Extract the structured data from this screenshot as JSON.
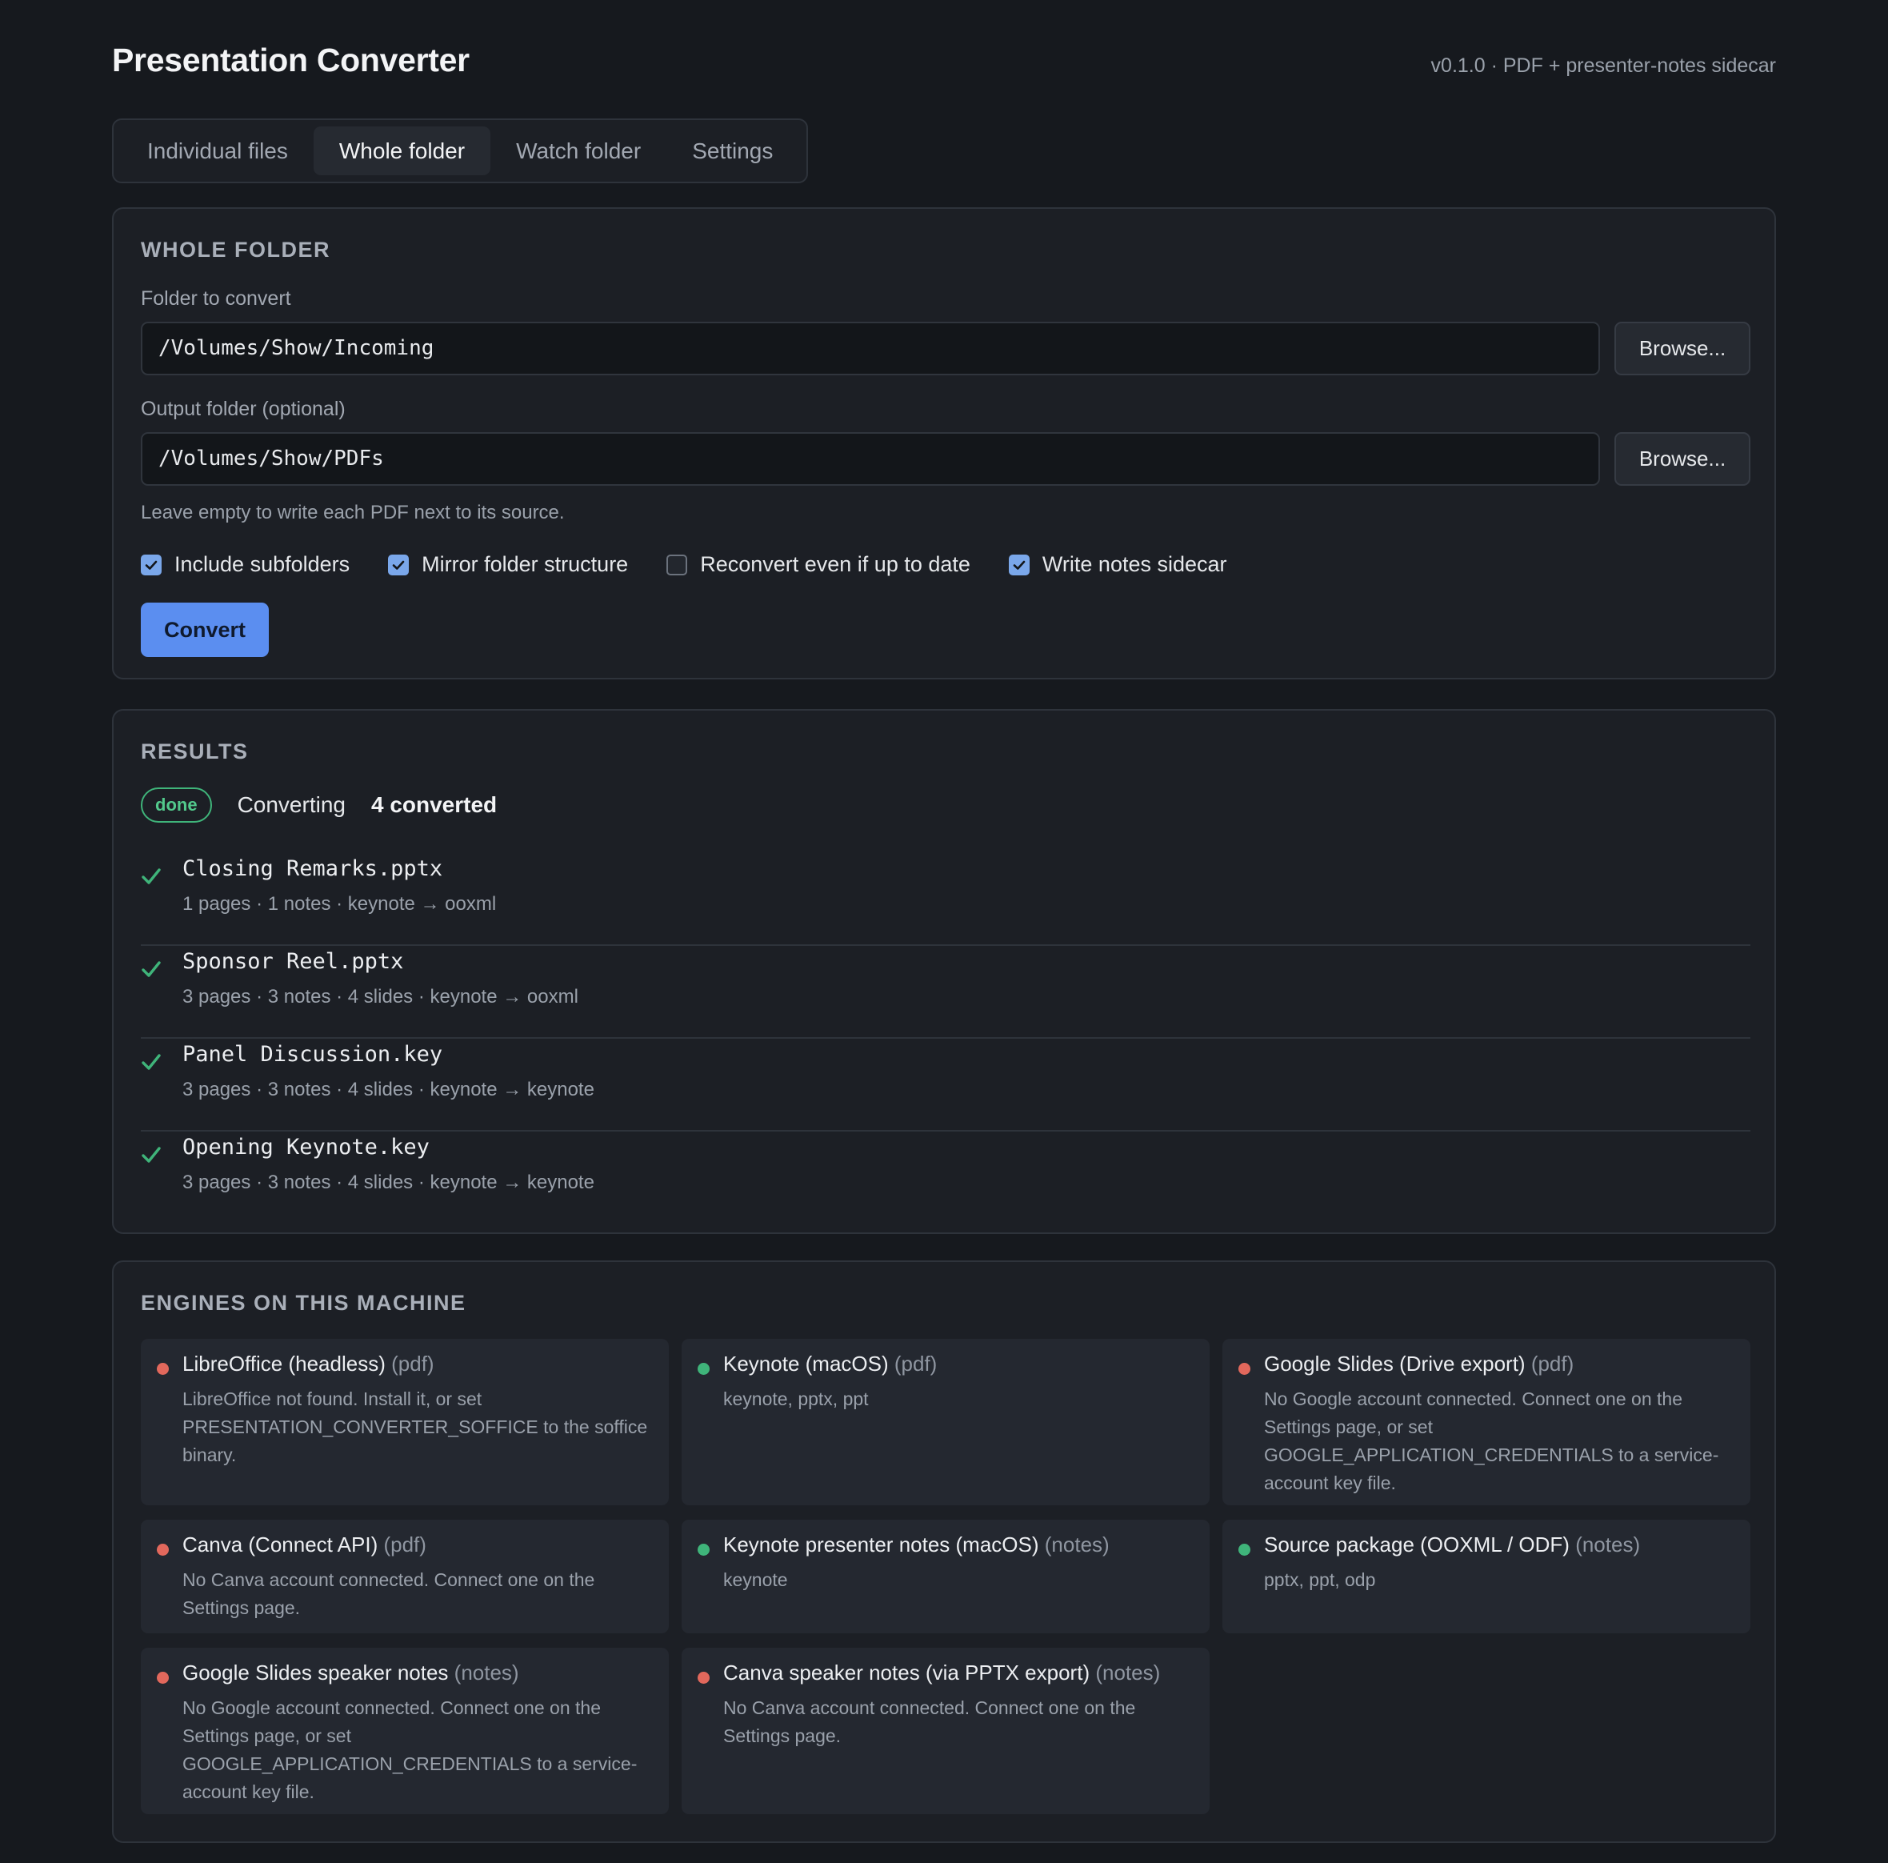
{
  "app": {
    "title": "Presentation Converter",
    "version": "v0.1.0 · PDF + presenter-notes sidecar"
  },
  "tabs": [
    {
      "label": "Individual files",
      "active": false
    },
    {
      "label": "Whole folder",
      "active": true
    },
    {
      "label": "Watch folder",
      "active": false
    },
    {
      "label": "Settings",
      "active": false
    }
  ],
  "whole_folder": {
    "section_title": "WHOLE FOLDER",
    "folder_label": "Folder to convert",
    "folder_value": "/Volumes/Show/Incoming",
    "browse_label": "Browse...",
    "output_label": "Output folder (optional)",
    "output_value": "/Volumes/Show/PDFs",
    "output_hint": "Leave empty to write each PDF next to its source.",
    "options": [
      {
        "label": "Include subfolders",
        "checked": true
      },
      {
        "label": "Mirror folder structure",
        "checked": true
      },
      {
        "label": "Reconvert even if up to date",
        "checked": false
      },
      {
        "label": "Write notes sidecar",
        "checked": true
      }
    ],
    "convert_label": "Convert"
  },
  "results": {
    "section_title": "RESULTS",
    "badge": "done",
    "status": "Converting",
    "count": "4 converted",
    "items": [
      {
        "name": "Closing Remarks.pptx",
        "meta": "1 pages · 1 notes · keynote → ooxml"
      },
      {
        "name": "Sponsor Reel.pptx",
        "meta": "3 pages · 3 notes · 4 slides · keynote → ooxml"
      },
      {
        "name": "Panel Discussion.key",
        "meta": "3 pages · 3 notes · 4 slides · keynote → keynote"
      },
      {
        "name": "Opening Keynote.key",
        "meta": "3 pages · 3 notes · 4 slides · keynote → keynote"
      }
    ]
  },
  "engines": {
    "section_title": "ENGINES ON THIS MACHINE",
    "items": [
      {
        "name": "LibreOffice (headless)",
        "kind": "(pdf)",
        "available": false,
        "status_color": "#e2685c",
        "description": "LibreOffice not found. Install it, or set PRESENTATION_CONVERTER_SOFFICE to the soffice binary."
      },
      {
        "name": "Keynote (macOS)",
        "kind": "(pdf)",
        "available": true,
        "status_color": "#3fb47a",
        "description": "keynote, pptx, ppt"
      },
      {
        "name": "Google Slides (Drive export)",
        "kind": "(pdf)",
        "available": false,
        "status_color": "#e2685c",
        "description": "No Google account connected. Connect one on the Settings page, or set GOOGLE_APPLICATION_CREDENTIALS to a service-account key file."
      },
      {
        "name": "Canva (Connect API)",
        "kind": "(pdf)",
        "available": false,
        "status_color": "#e2685c",
        "description": "No Canva account connected. Connect one on the Settings page."
      },
      {
        "name": "Keynote presenter notes (macOS)",
        "kind": "(notes)",
        "available": true,
        "status_color": "#3fb47a",
        "description": "keynote"
      },
      {
        "name": "Source package (OOXML / ODF)",
        "kind": "(notes)",
        "available": true,
        "status_color": "#3fb47a",
        "description": "pptx, ppt, odp"
      },
      {
        "name": "Google Slides speaker notes",
        "kind": "(notes)",
        "available": false,
        "status_color": "#e2685c",
        "description": "No Google account connected. Connect one on the Settings page, or set GOOGLE_APPLICATION_CREDENTIALS to a service-account key file."
      },
      {
        "name": "Canva speaker notes (via PPTX export)",
        "kind": "(notes)",
        "available": false,
        "status_color": "#e2685c",
        "description": "No Canva account connected. Connect one on the Settings page."
      }
    ]
  }
}
